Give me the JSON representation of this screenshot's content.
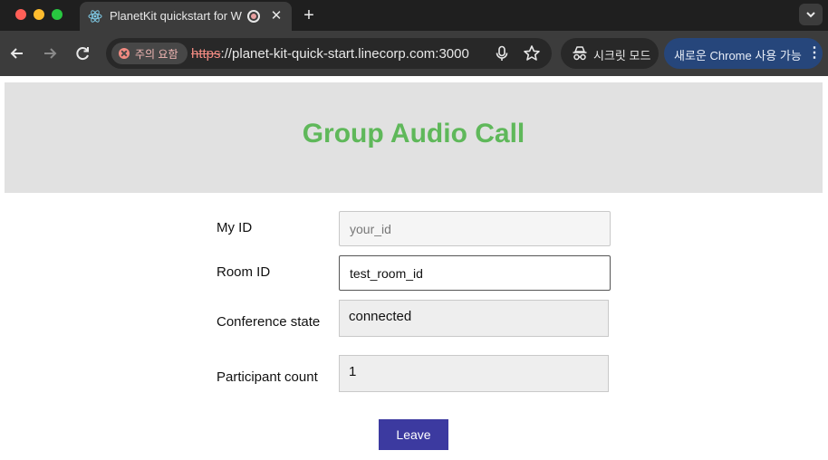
{
  "browser": {
    "tab": {
      "title": "PlanetKit quickstart for W",
      "close": "✕"
    },
    "new_tab": "+",
    "address": {
      "security_chip": "주의 요함",
      "url_scheme": "https",
      "url_rest": "://planet-kit-quick-start.linecorp.com:3000"
    },
    "incognito_label": "시크릿 모드",
    "update_label": "새로운 Chrome 사용 가능",
    "update_menu": "⋮"
  },
  "page": {
    "title": "Group Audio Call",
    "fields": {
      "my_id": {
        "label": "My ID",
        "value": "",
        "placeholder": "your_id"
      },
      "room_id": {
        "label": "Room ID",
        "value": "test_room_id"
      },
      "conference_state": {
        "label": "Conference state",
        "value": "connected"
      },
      "participant_count": {
        "label": "Participant count",
        "value": "1"
      }
    },
    "leave_button": "Leave"
  },
  "colors": {
    "title_green": "#5fb85a",
    "leave_button": "#3c3aa0",
    "header_bg": "#e1e1e1"
  }
}
